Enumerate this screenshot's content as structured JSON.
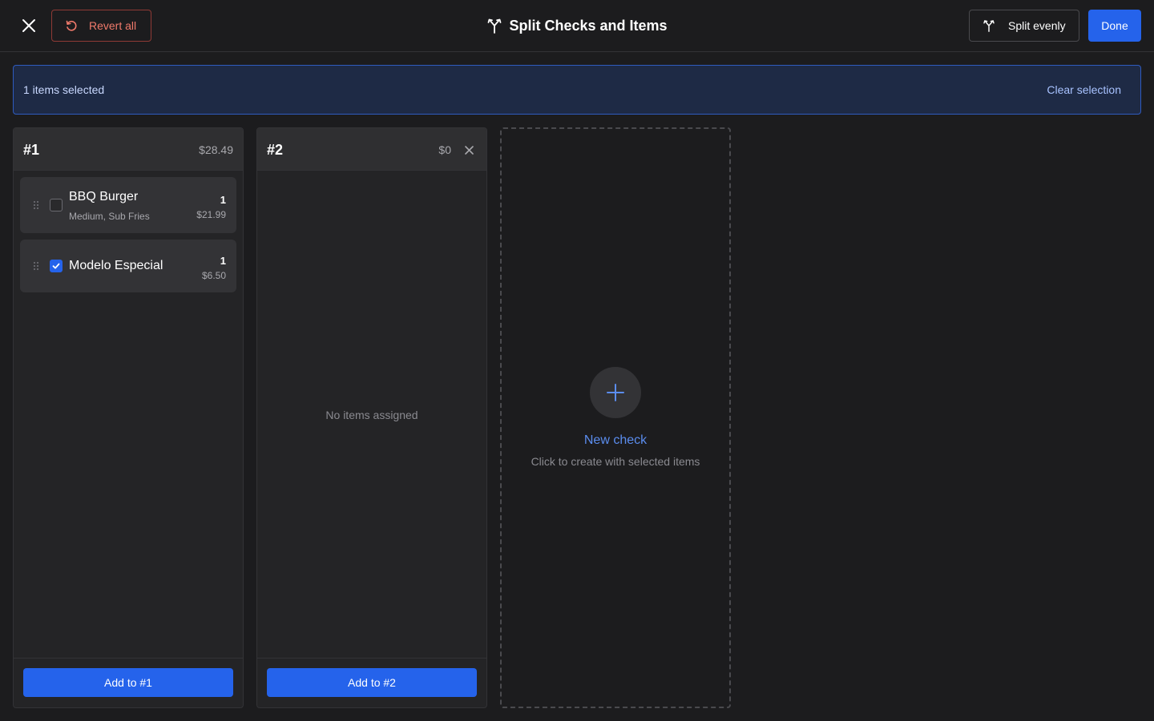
{
  "header": {
    "title": "Split Checks and Items",
    "revert_label": "Revert all",
    "split_evenly_label": "Split evenly",
    "done_label": "Done"
  },
  "selection": {
    "text": "1 items selected",
    "clear_label": "Clear selection"
  },
  "checks": [
    {
      "name": "#1",
      "total": "$28.49",
      "add_label": "Add to #1",
      "items": [
        {
          "name": "BBQ Burger",
          "modifiers": "Medium, Sub Fries",
          "qty": "1",
          "price": "$21.99",
          "selected": false
        },
        {
          "name": "Modelo Especial",
          "modifiers": "",
          "qty": "1",
          "price": "$6.50",
          "selected": true
        }
      ]
    },
    {
      "name": "#2",
      "total": "$0",
      "add_label": "Add to #2",
      "empty_text": "No items assigned",
      "items": []
    }
  ],
  "new_check": {
    "title": "New check",
    "subtitle": "Click to create with selected items"
  },
  "colors": {
    "background": "#1c1c1e",
    "accent": "#2563eb",
    "danger": "#f07a6b",
    "link": "#5b8def",
    "banner_bg": "#1e2a45"
  },
  "icons": {
    "close": "close-icon",
    "revert": "revert-icon",
    "split": "split-icon",
    "add": "plus-icon",
    "drag": "drag-handle-icon",
    "check": "checkmark-icon"
  }
}
